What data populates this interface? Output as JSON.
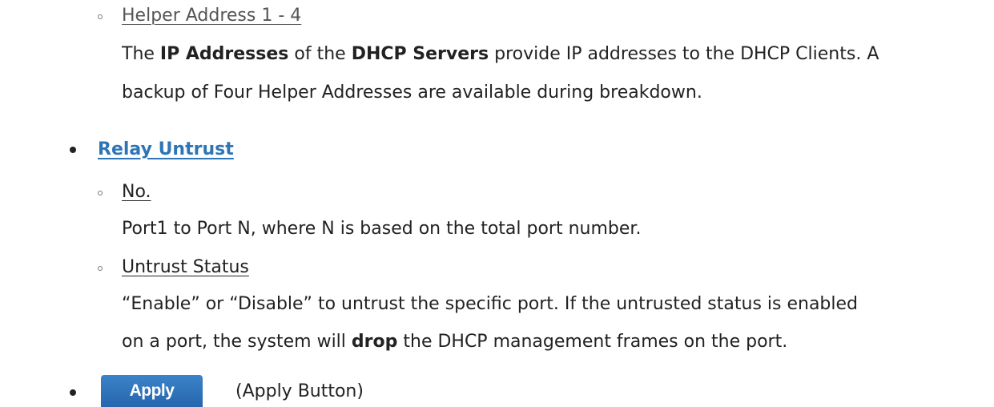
{
  "helper": {
    "title": "Helper Address 1 - 4",
    "line1_pre": "The ",
    "line1_b1": "IP Addresses",
    "line1_mid": " of the ",
    "line1_b2": "DHCP Servers",
    "line1_post": " provide IP addresses to the DHCP Clients. A",
    "line2": "backup of Four Helper Addresses are available during breakdown."
  },
  "relay_untrust": {
    "title": "Relay Untrust",
    "no": {
      "title": "No.",
      "desc": "Port1 to Port N, where N is based on the total port number."
    },
    "untrust_status": {
      "title": "Untrust Status",
      "line1": "“Enable” or “Disable” to untrust the specific port. If the untrusted status is enabled",
      "line2_pre": "on a port, the system will ",
      "line2_bold": "drop",
      "line2_post": " the DHCP management frames on the port."
    }
  },
  "apply": {
    "button_label": "Apply",
    "caption": "(Apply Button)"
  }
}
